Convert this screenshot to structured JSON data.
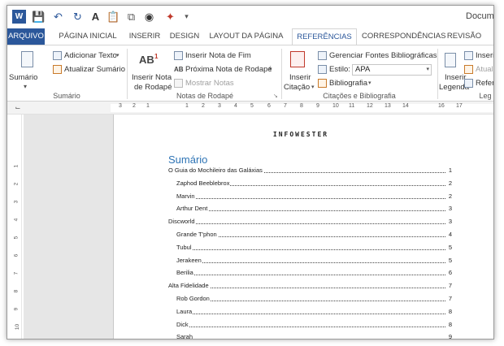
{
  "title_bar": {
    "doc_title": "Docume"
  },
  "tabs": [
    {
      "label": "ARQUIVO"
    },
    {
      "label": "PÁGINA INICIAL"
    },
    {
      "label": "INSERIR"
    },
    {
      "label": "DESIGN"
    },
    {
      "label": "LAYOUT DA PÁGINA"
    },
    {
      "label": "REFERÊNCIAS"
    },
    {
      "label": "CORRESPONDÊNCIAS"
    },
    {
      "label": "REVISÃO"
    }
  ],
  "active_tab": "REFERÊNCIAS",
  "ribbon": {
    "sumario": {
      "big_button": "Sumário",
      "add_text": "Adicionar Texto",
      "update": "Atualizar Sumário",
      "group_label": "Sumário"
    },
    "notas": {
      "insert_note_1": "Inserir Nota",
      "insert_note_2": "de Rodapé",
      "ab_glyph": "AB",
      "endnote": "Inserir Nota de Fim",
      "next_note": "Próxima Nota de Rodapé",
      "show_notes": "Mostrar Notas",
      "group_label": "Notas de Rodapé"
    },
    "citacoes": {
      "insert_1": "Inserir",
      "insert_2": "Citação",
      "manage": "Gerenciar Fontes Bibliográficas",
      "style_label": "Estilo:",
      "style_value": "APA",
      "bibliography": "Bibliografia",
      "group_label": "Citações e Bibliografia"
    },
    "legendas": {
      "insert_1": "Inserir",
      "insert_2": "Legenda",
      "insert_small": "Inseri",
      "update_small": "Atual",
      "ref_small": "Refer",
      "group_label": "Leg"
    }
  },
  "ruler": {
    "h_numbers": [
      "3",
      "2",
      "1",
      "1",
      "2",
      "3",
      "4",
      "5",
      "6",
      "7",
      "8",
      "9",
      "10",
      "11",
      "12",
      "13",
      "14",
      "16",
      "17"
    ],
    "v_numbers": [
      "1",
      "2",
      "3",
      "4",
      "5",
      "6",
      "7",
      "8",
      "9",
      "10"
    ]
  },
  "document": {
    "header_logo": "INFOWESTER",
    "toc_heading": "Sumário",
    "toc": [
      {
        "text": "O Guia do Mochileiro das Galáxias",
        "page": "1",
        "level": 1
      },
      {
        "text": "Zaphod Beeblebrox",
        "page": "2",
        "level": 2
      },
      {
        "text": "Marvin",
        "page": "2",
        "level": 2
      },
      {
        "text": "Arthur Dent",
        "page": "3",
        "level": 2
      },
      {
        "text": "Discworld",
        "page": "3",
        "level": 1
      },
      {
        "text": "Grande T'phon",
        "page": "4",
        "level": 2
      },
      {
        "text": "Tubul",
        "page": "5",
        "level": 2
      },
      {
        "text": "Jerakeen",
        "page": "5",
        "level": 2
      },
      {
        "text": "Berilia",
        "page": "6",
        "level": 2
      },
      {
        "text": "Alta Fidelidade",
        "page": "7",
        "level": 1
      },
      {
        "text": "Rob Gordon",
        "page": "7",
        "level": 2
      },
      {
        "text": "Laura",
        "page": "8",
        "level": 2
      },
      {
        "text": "Dick",
        "page": "8",
        "level": 2
      },
      {
        "text": "Sarah",
        "page": "9",
        "level": 2
      }
    ]
  },
  "icons": [
    "word-logo-icon",
    "save-icon",
    "undo-icon",
    "redo-icon",
    "font-size-icon",
    "paste-icon",
    "copy-icon",
    "find-icon",
    "format-painter-icon",
    "customize-qat-icon"
  ],
  "colors": {
    "accent": "#2b579a",
    "heading": "#2e74b5",
    "canvas": "#e6e6e6"
  }
}
